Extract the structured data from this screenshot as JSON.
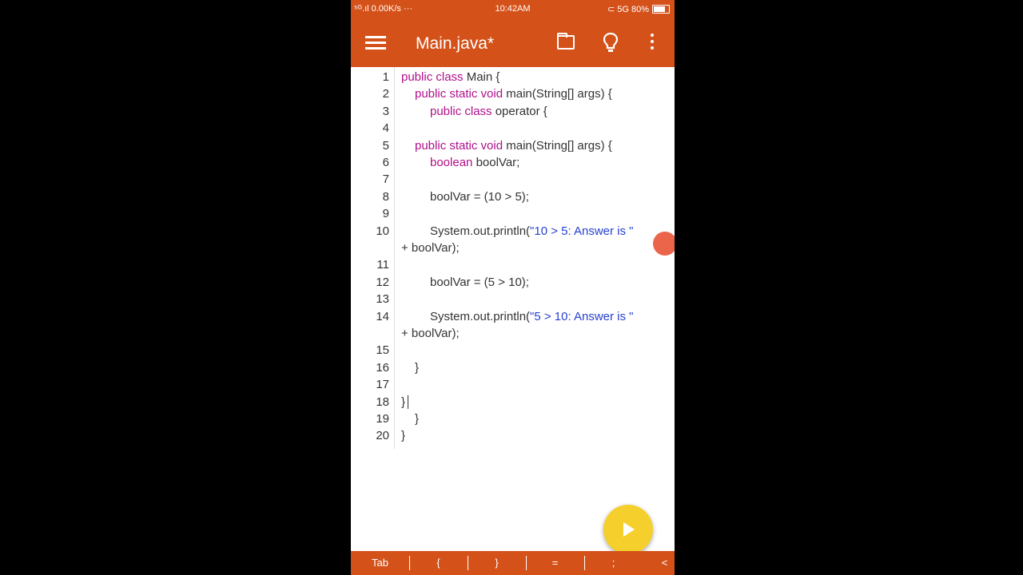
{
  "status_bar": {
    "left": "⁵ᴳ.ıl 0.00K/s ···",
    "time": "10:42AM",
    "right": "⊂ 5G 80%",
    "battery_level": 0.8
  },
  "app_bar": {
    "title": "Main.java*"
  },
  "editor": {
    "lines": [
      {
        "num": "1",
        "indent": 0,
        "parts": [
          {
            "t": "public class ",
            "c": "kw"
          },
          {
            "t": "Main {",
            "c": "plain"
          }
        ]
      },
      {
        "num": "2",
        "indent": 1,
        "parts": [
          {
            "t": "public static void ",
            "c": "kw"
          },
          {
            "t": "main(String[] args) {",
            "c": "plain"
          }
        ]
      },
      {
        "num": "3",
        "indent": 2,
        "parts": [
          {
            "t": "public class ",
            "c": "kw"
          },
          {
            "t": "operator {",
            "c": "plain"
          }
        ]
      },
      {
        "num": "4",
        "indent": 0,
        "parts": []
      },
      {
        "num": "5",
        "indent": 1,
        "parts": [
          {
            "t": "public static void ",
            "c": "kw"
          },
          {
            "t": "main(String[] args) {",
            "c": "plain"
          }
        ]
      },
      {
        "num": "6",
        "indent": 2,
        "parts": [
          {
            "t": "boolean ",
            "c": "kw"
          },
          {
            "t": "boolVar;",
            "c": "plain"
          }
        ]
      },
      {
        "num": "7",
        "indent": 0,
        "parts": []
      },
      {
        "num": "8",
        "indent": 2,
        "parts": [
          {
            "t": "boolVar = (10 > 5);",
            "c": "plain"
          }
        ]
      },
      {
        "num": "9",
        "indent": 0,
        "parts": []
      },
      {
        "num": "10",
        "indent": 2,
        "parts": [
          {
            "t": "System.out.println(",
            "c": "plain"
          },
          {
            "t": "\"10 > 5: Answer is \"",
            "c": "str"
          }
        ]
      },
      {
        "num": "",
        "indent": 0,
        "parts": [
          {
            "t": "+ boolVar);",
            "c": "plain"
          }
        ]
      },
      {
        "num": "11",
        "indent": 0,
        "parts": []
      },
      {
        "num": "12",
        "indent": 2,
        "parts": [
          {
            "t": "boolVar = (5 > 10);",
            "c": "plain"
          }
        ]
      },
      {
        "num": "13",
        "indent": 0,
        "parts": []
      },
      {
        "num": "14",
        "indent": 2,
        "parts": [
          {
            "t": "System.out.println(",
            "c": "plain"
          },
          {
            "t": "\"5 > 10: Answer is \"",
            "c": "str"
          }
        ]
      },
      {
        "num": "",
        "indent": 0,
        "parts": [
          {
            "t": "+ boolVar);",
            "c": "plain"
          }
        ]
      },
      {
        "num": "15",
        "indent": 0,
        "parts": []
      },
      {
        "num": "16",
        "indent": 1,
        "parts": [
          {
            "t": "}",
            "c": "plain"
          }
        ]
      },
      {
        "num": "17",
        "indent": 0,
        "parts": []
      },
      {
        "num": "18",
        "indent": 0,
        "parts": [
          {
            "t": "}",
            "c": "plain"
          }
        ]
      },
      {
        "num": "19",
        "indent": 1,
        "parts": [
          {
            "t": "}",
            "c": "plain"
          }
        ]
      },
      {
        "num": "20",
        "indent": 0,
        "parts": [
          {
            "t": "}",
            "c": "plain"
          }
        ]
      }
    ]
  },
  "run_button": {
    "icon": "play-icon"
  },
  "key_bar": {
    "keys": [
      "Tab",
      "{",
      "}",
      "=",
      ";",
      "<"
    ]
  },
  "colors": {
    "accent": "#d4521a",
    "keyword": "#b1108a",
    "string": "#2540d0",
    "fab": "#f5d02c"
  }
}
